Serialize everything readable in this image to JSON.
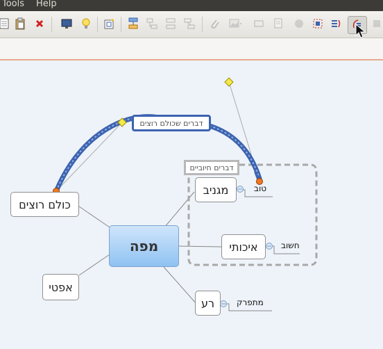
{
  "menubar": {
    "items": [
      "Tools",
      "Help"
    ]
  },
  "toolbar": {
    "buttons": [
      {
        "icon": "page-icon"
      },
      {
        "icon": "paste-icon"
      },
      {
        "icon": "delete-icon"
      },
      {
        "icon": "monitor-icon"
      },
      {
        "icon": "lightbulb-icon"
      },
      {
        "icon": "image-add-icon"
      },
      {
        "icon": "topic-icon"
      },
      {
        "icon": "subtopic-icon"
      },
      {
        "icon": "detached-topic-icon"
      },
      {
        "icon": "floating-topic-icon"
      },
      {
        "icon": "attachment-icon"
      },
      {
        "icon": "image-icon"
      },
      {
        "icon": "label-icon"
      },
      {
        "icon": "note-icon"
      },
      {
        "icon": "marker-icon"
      },
      {
        "icon": "boundary-icon"
      },
      {
        "icon": "summary-icon"
      },
      {
        "icon": "relationship-icon"
      },
      {
        "icon": "stop-icon"
      }
    ]
  },
  "map": {
    "central": "מפה",
    "topics": {
      "everyone": "כולם רוצים",
      "neutral": "אפטי",
      "bad": "רע",
      "cool": "מגניב",
      "quality": "איכותי"
    },
    "subtopics": {
      "good": "טוב",
      "important": "חשוב",
      "exciting": "מתפרק"
    },
    "relationship_label": "דברים שכולם רוצים",
    "boundary_label": "דברים חיוביים"
  },
  "colors": {
    "relationship": "#3d63b0",
    "boundary": "#a8a8a8",
    "central_top": "#cfe5fb",
    "central_bottom": "#8fc2f2",
    "accent_line": "#e8a98f"
  }
}
